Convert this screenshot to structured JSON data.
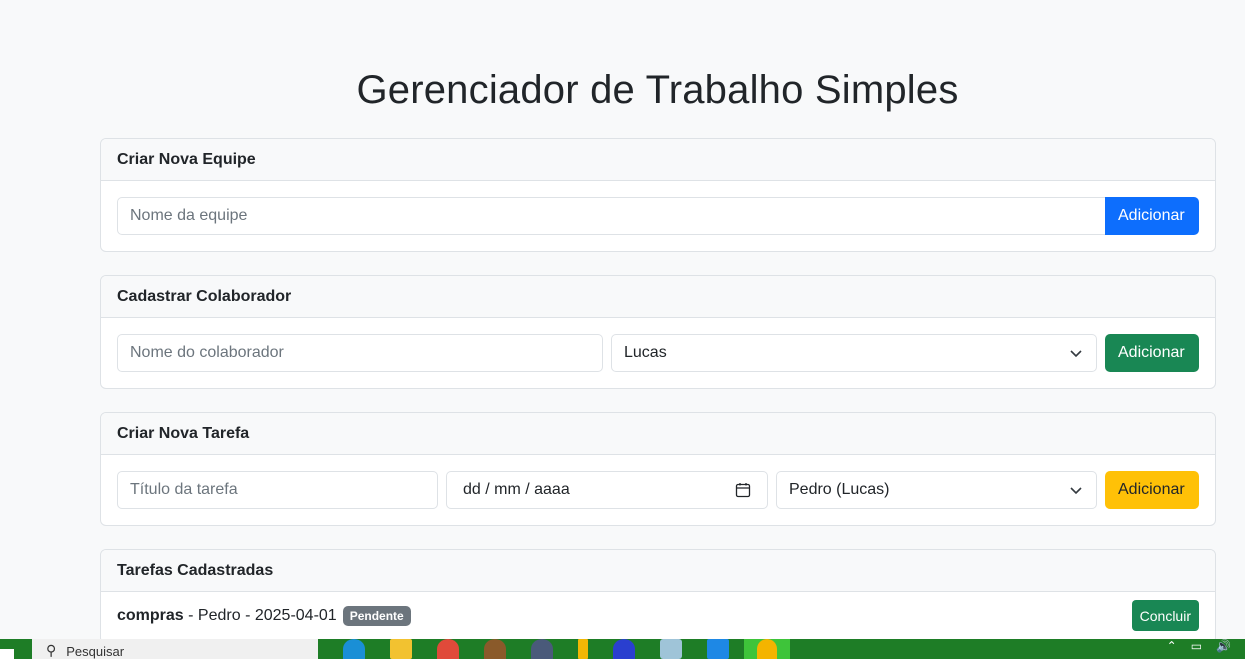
{
  "page": {
    "title": "Gerenciador de Trabalho Simples"
  },
  "team_card": {
    "header": "Criar Nova Equipe",
    "name_placeholder": "Nome da equipe",
    "add_label": "Adicionar"
  },
  "collaborator_card": {
    "header": "Cadastrar Colaborador",
    "name_placeholder": "Nome do colaborador",
    "team_selected": "Lucas",
    "add_label": "Adicionar"
  },
  "task_card": {
    "header": "Criar Nova Tarefa",
    "title_placeholder": "Título da tarefa",
    "date_placeholder": "dd / mm / aaaa",
    "assignee_selected": "Pedro (Lucas)",
    "add_label": "Adicionar"
  },
  "tasks_card": {
    "header": "Tarefas Cadastradas",
    "tasks": [
      {
        "title": "compras",
        "person": "Pedro",
        "date": "2025-04-01",
        "status": "Pendente",
        "action": "Concluir"
      }
    ]
  },
  "taskbar": {
    "search_text": "Pesquisar"
  },
  "colors": {
    "primary": "#0d6efd",
    "success": "#198754",
    "warning": "#ffc107",
    "secondary": "#6c757d"
  }
}
